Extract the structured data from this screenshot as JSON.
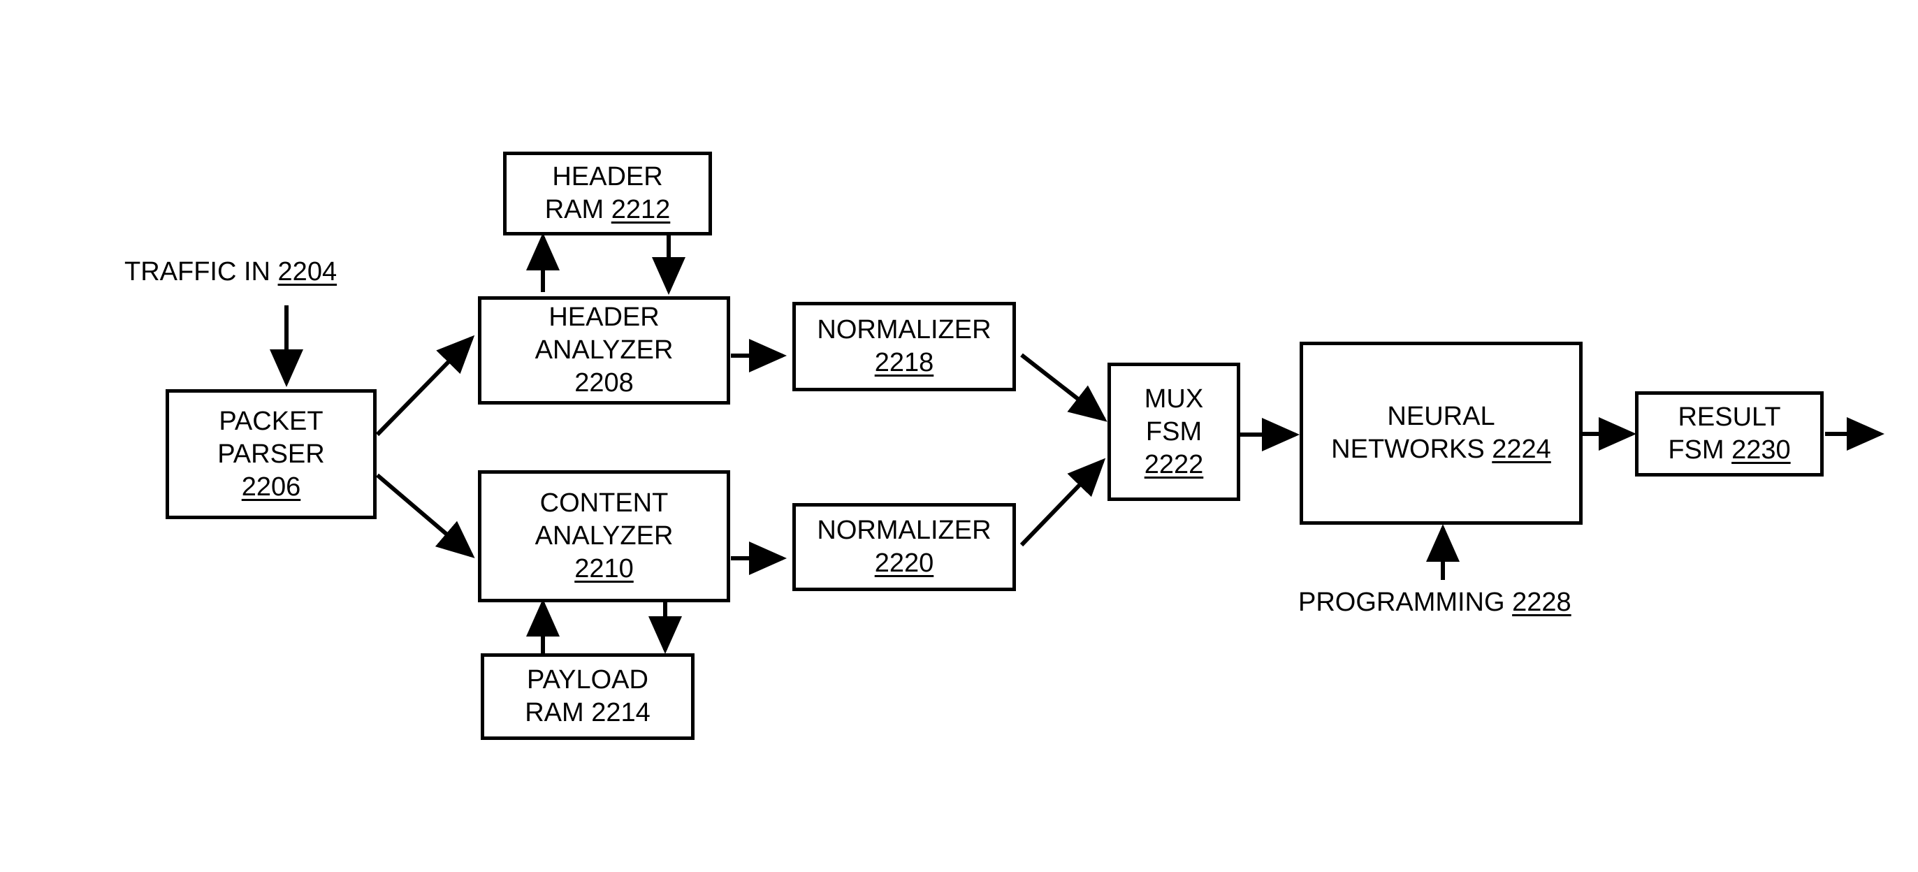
{
  "diagram": {
    "nodes": {
      "traffic_in": {
        "text": "TRAFFIC IN",
        "ref": "2204"
      },
      "packet_parser": {
        "line1": "PACKET",
        "line2": "PARSER",
        "ref": "2206"
      },
      "header_ram": {
        "line1": "HEADER",
        "line2": "RAM",
        "ref": "2212"
      },
      "header_analyzer": {
        "line1": "HEADER",
        "line2": "ANALYZER",
        "ref": "2208"
      },
      "content_analyzer": {
        "line1": "CONTENT",
        "line2": "ANALYZER",
        "ref": "2210"
      },
      "payload_ram": {
        "line1": "PAYLOAD",
        "line2": "RAM 2214"
      },
      "normalizer_a": {
        "line1": "NORMALIZER",
        "ref": "2218"
      },
      "normalizer_b": {
        "line1": "NORMALIZER",
        "ref": "2220"
      },
      "mux_fsm": {
        "line1": "MUX",
        "line2": "FSM",
        "ref": "2222"
      },
      "neural_networks": {
        "line1": "NEURAL",
        "line2": "NETWORKS",
        "ref": "2224"
      },
      "programming": {
        "text": "PROGRAMMING",
        "ref": "2228"
      },
      "result_fsm": {
        "line1": "RESULT",
        "line2": "FSM",
        "ref": "2230"
      }
    },
    "edges": [
      {
        "from": "traffic_in",
        "to": "packet_parser"
      },
      {
        "from": "packet_parser",
        "to": "header_analyzer"
      },
      {
        "from": "packet_parser",
        "to": "content_analyzer"
      },
      {
        "from": "header_analyzer",
        "to": "header_ram"
      },
      {
        "from": "header_ram",
        "to": "header_analyzer"
      },
      {
        "from": "content_analyzer",
        "to": "payload_ram"
      },
      {
        "from": "payload_ram",
        "to": "content_analyzer"
      },
      {
        "from": "header_analyzer",
        "to": "normalizer_a"
      },
      {
        "from": "content_analyzer",
        "to": "normalizer_b"
      },
      {
        "from": "normalizer_a",
        "to": "mux_fsm"
      },
      {
        "from": "normalizer_b",
        "to": "mux_fsm"
      },
      {
        "from": "mux_fsm",
        "to": "neural_networks"
      },
      {
        "from": "programming",
        "to": "neural_networks"
      },
      {
        "from": "neural_networks",
        "to": "result_fsm"
      },
      {
        "from": "result_fsm",
        "to": "output"
      }
    ]
  }
}
